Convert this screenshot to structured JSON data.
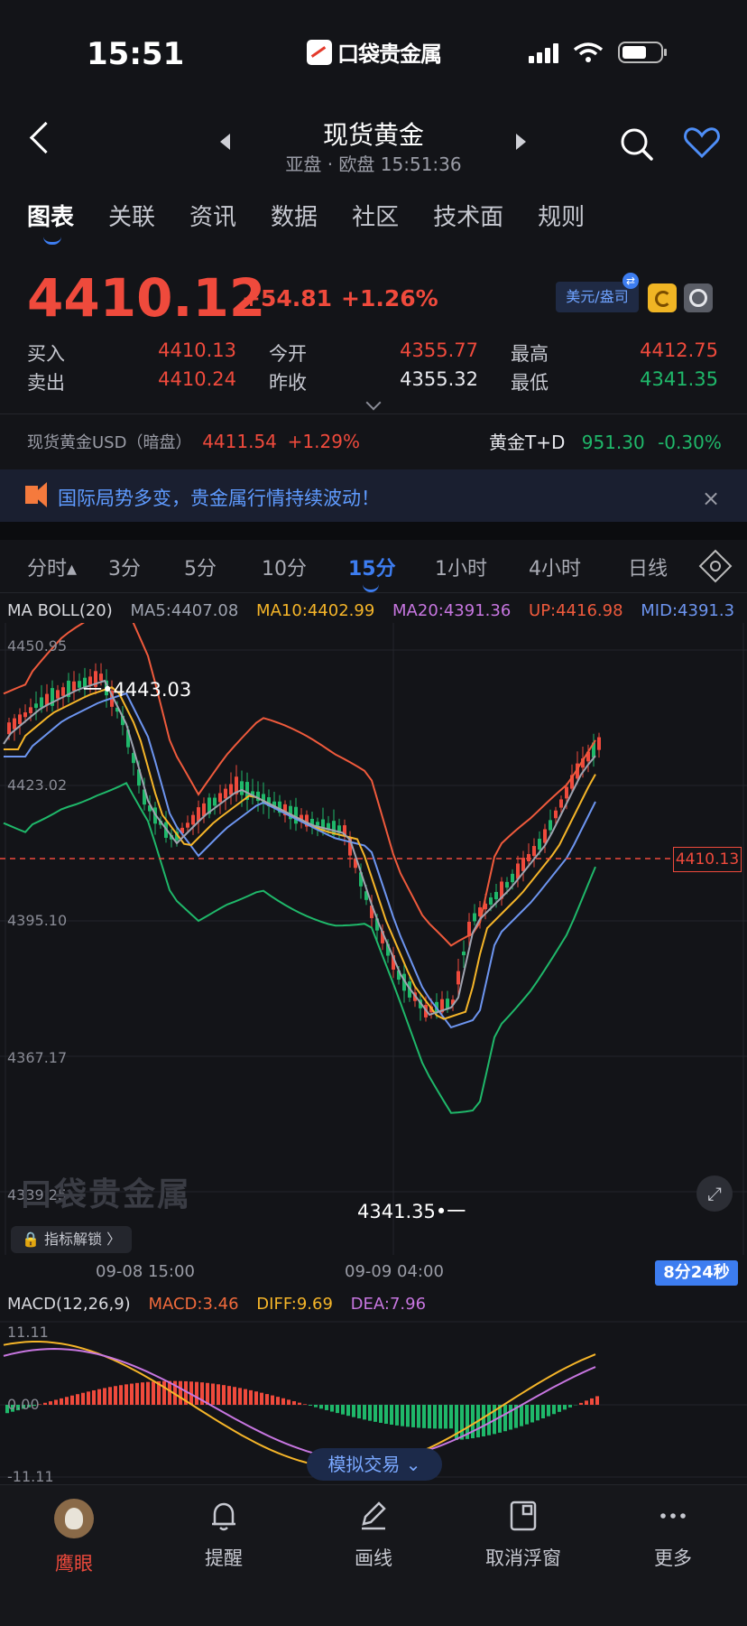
{
  "status_bar": {
    "time": "15:51",
    "app_name": "口袋贵金属"
  },
  "header": {
    "title": "现货黄金",
    "subtitle": "亚盘 · 欧盘 15:51:36"
  },
  "main_tabs": [
    {
      "label": "图表",
      "active": true
    },
    {
      "label": "关联"
    },
    {
      "label": "资讯"
    },
    {
      "label": "数据"
    },
    {
      "label": "社区"
    },
    {
      "label": "技术面"
    },
    {
      "label": "规则"
    }
  ],
  "quote": {
    "last_price": "4410.12",
    "change": "+54.81",
    "change_pct": "+1.26%",
    "currency_unit": "美元/盎司",
    "swap_glyph": "⇄",
    "rows": [
      {
        "l1": "买入",
        "v1": "4410.13",
        "l2": "今开",
        "v2": "4355.77",
        "l3": "最高",
        "v3": "4412.75"
      },
      {
        "l1": "卖出",
        "v1": "4410.24",
        "l2": "昨收",
        "v2": "4355.32",
        "l3": "最低",
        "v3": "4341.35"
      }
    ]
  },
  "ticker": {
    "left_label": "现货黄金USD（暗盘）",
    "left_value": "4411.54",
    "left_pct": "+1.29%",
    "right_label": "黄金T+D",
    "right_value": "951.30",
    "right_pct": "-0.30%"
  },
  "banner": {
    "text": "国际局势多变，贵金属行情持续波动！",
    "close": "×"
  },
  "period_tabs": [
    {
      "label": "分时▴"
    },
    {
      "label": "3分"
    },
    {
      "label": "5分"
    },
    {
      "label": "10分"
    },
    {
      "label": "15分",
      "active": true
    },
    {
      "label": "1小时"
    },
    {
      "label": "4小时"
    },
    {
      "label": "日线"
    }
  ],
  "ma_legend": {
    "name": "MA BOLL(20)",
    "ma5": "MA5:4407.08",
    "ma10": "MA10:4402.99",
    "ma20": "MA20:4391.36",
    "up": "UP:4416.98",
    "mid": "MID:4391.3"
  },
  "macd_legend": {
    "name": "MACD(12,26,9)",
    "macd": "MACD:3.46",
    "diff": "DIFF:9.69",
    "dea": "DEA:7.96"
  },
  "chart": {
    "y_ticks": [
      "4450.95",
      "4423.02",
      "4395.10",
      "4367.17",
      "4339.25"
    ],
    "high_label": "一•4443.03",
    "low_label": "4341.35•一",
    "current_tag": "4410.13",
    "watermark": "口袋贵金属",
    "unlock_label": "指标解锁 〉",
    "time_labels": [
      "09-08 15:00",
      "09-09 04:00"
    ],
    "countdown": "8分24秒",
    "macd_ticks": [
      "11.11",
      "0.00",
      "-11.11"
    ],
    "sim_trade": "模拟交易 ⌄"
  },
  "bottom_nav": [
    {
      "label": "鹰眼",
      "icon": "eagle-avatar-icon",
      "active": true
    },
    {
      "label": "提醒",
      "icon": "bell-icon"
    },
    {
      "label": "画线",
      "icon": "pen-icon"
    },
    {
      "label": "取消浮窗",
      "icon": "float-window-icon"
    },
    {
      "label": "更多",
      "icon": "more-icon"
    }
  ],
  "colors": {
    "up": "#ef4a3c",
    "down": "#1fb86a",
    "accent": "#3d7df0",
    "ma5": "#9ea3b0",
    "ma10": "#f5b529",
    "ma20": "#c776e0",
    "boll_up": "#ef5a3c",
    "boll_mid": "#6d95f0",
    "boll_low": "#1fb86a"
  }
}
